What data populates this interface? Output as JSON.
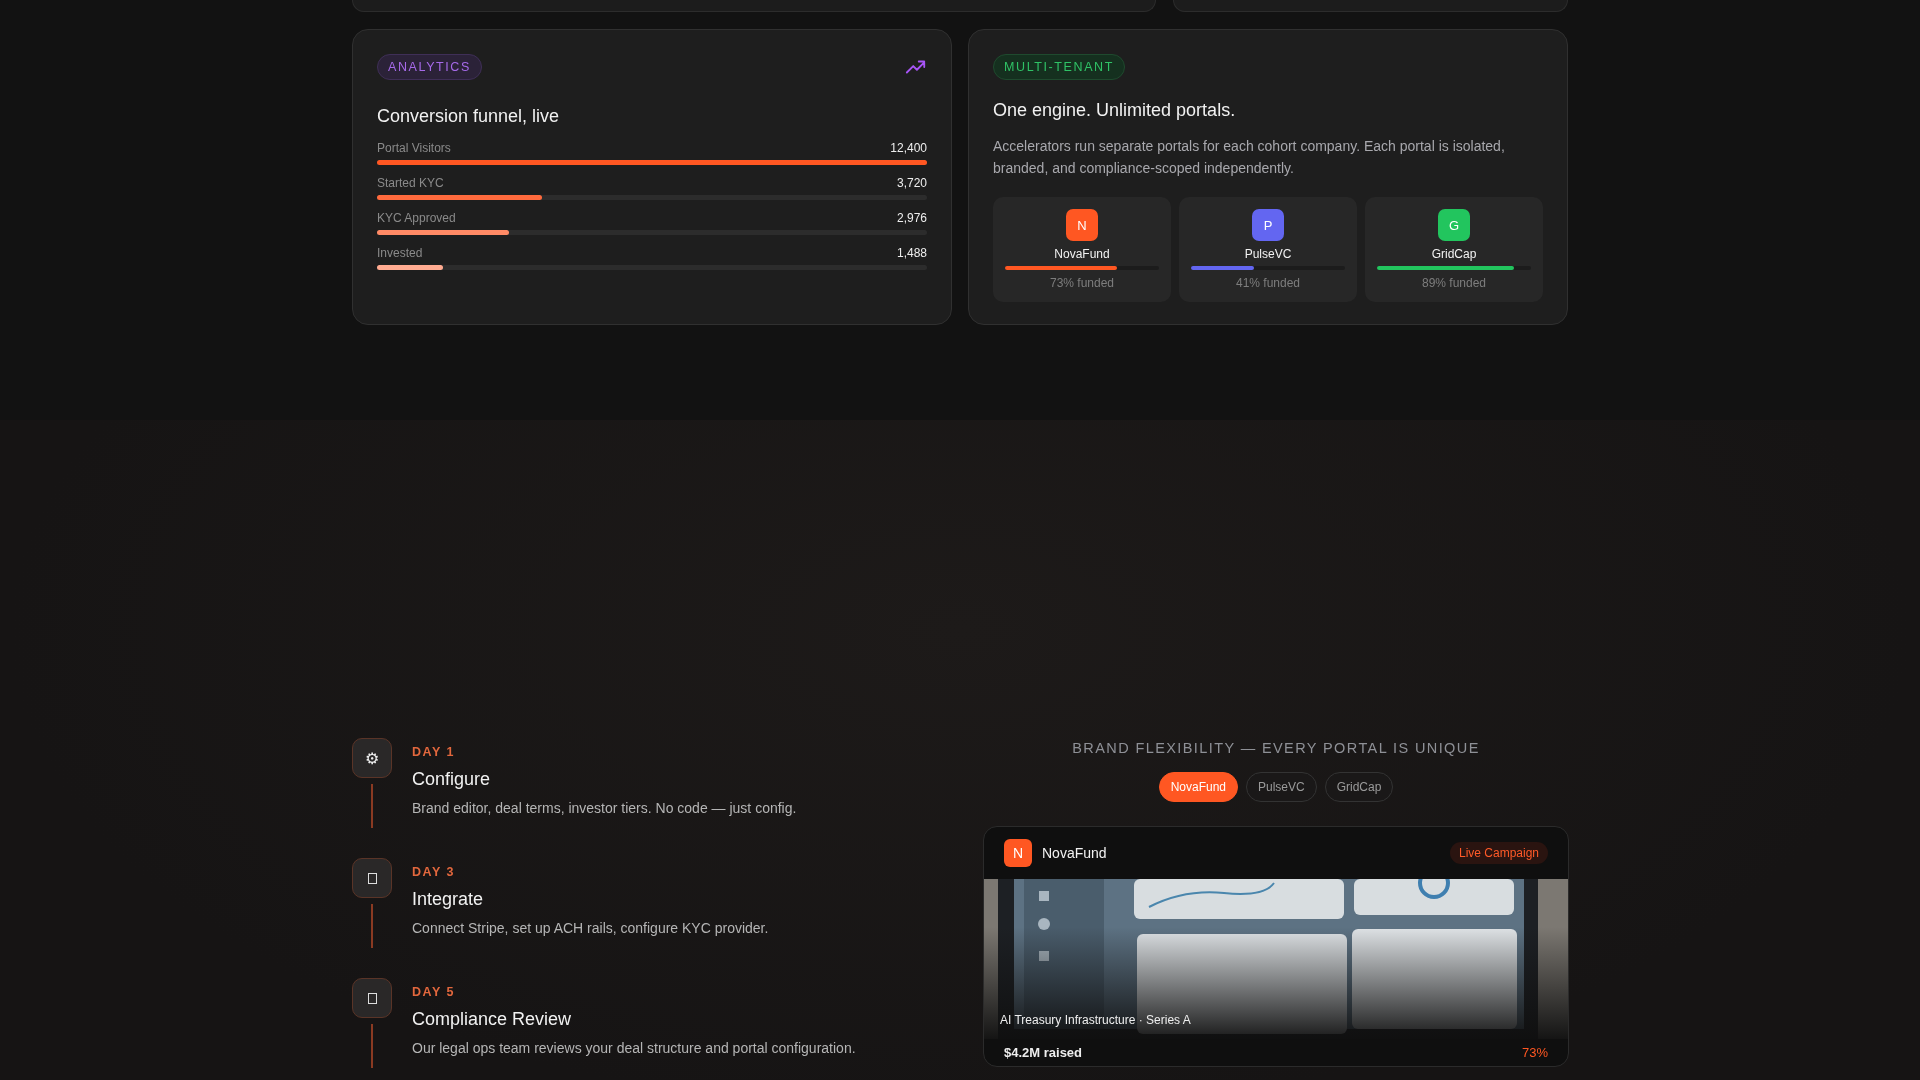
{
  "analytics": {
    "badge": "ANALYTICS",
    "title": "Conversion funnel, live",
    "rows": [
      {
        "label": "Portal Visitors",
        "value": "12,400",
        "level": 1.0,
        "color": "#ff5722"
      },
      {
        "label": "Started KYC",
        "value": "3,720",
        "level": 0.3,
        "color": "#ff6a3d"
      },
      {
        "label": "KYC Approved",
        "value": "2,976",
        "level": 0.24,
        "color": "#ff8a65"
      },
      {
        "label": "Invested",
        "value": "1,488",
        "level": 0.12,
        "color": "#ffab91"
      }
    ]
  },
  "multi_tenant": {
    "badge": "MULTI-TENANT",
    "title": "One engine. Unlimited portals.",
    "description": "Accelerators run separate portals for each cohort company. Each portal is isolated, branded, and compliance-scoped independently.",
    "portals": [
      {
        "initial": "N",
        "name": "NovaFund",
        "color": "#ff5722",
        "level": 0.73,
        "funded": "73% funded"
      },
      {
        "initial": "P",
        "name": "PulseVC",
        "color": "#6366f1",
        "level": 0.41,
        "funded": "41% funded"
      },
      {
        "initial": "G",
        "name": "GridCap",
        "color": "#22c55e",
        "level": 0.89,
        "funded": "89% funded"
      }
    ]
  },
  "timeline": [
    {
      "day": "DAY 1",
      "title": "Configure",
      "description": "Brand editor, deal terms, investor tiers. No code — just config.",
      "icon": {
        "kind": "glyph",
        "text": "⚙"
      }
    },
    {
      "day": "DAY 3",
      "title": "Integrate",
      "description": "Connect Stripe, set up ACH rails, configure KYC provider.",
      "icon": {
        "kind": "box"
      }
    },
    {
      "day": "DAY 5",
      "title": "Compliance Review",
      "description": "Our legal ops team reviews your deal structure and portal configuration.",
      "icon": {
        "kind": "box"
      }
    }
  ],
  "brand": {
    "heading": "BRAND FLEXIBILITY — EVERY PORTAL IS UNIQUE",
    "tabs": [
      {
        "label": "NovaFund",
        "selected": true
      },
      {
        "label": "PulseVC",
        "selected": false
      },
      {
        "label": "GridCap",
        "selected": false
      }
    ],
    "card": {
      "initial": "N",
      "name": "NovaFund",
      "status": "Live Campaign",
      "caption": "AI Treasury Infrastructure · Series A",
      "raised": "$4.2M raised",
      "percent": "73%"
    }
  }
}
